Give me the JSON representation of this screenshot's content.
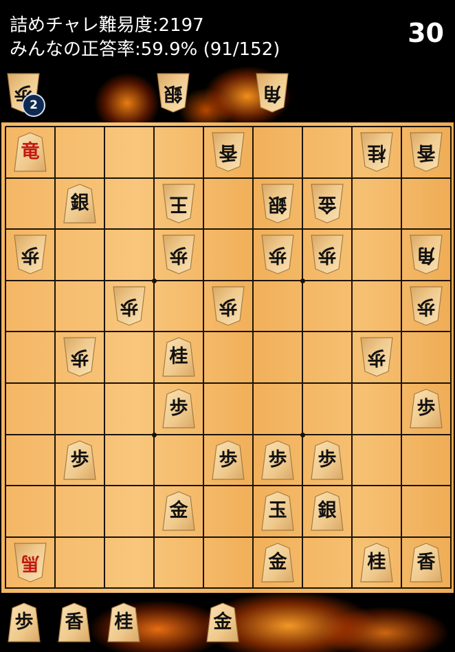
{
  "header": {
    "difficulty": "詰めチャレ難易度:2197",
    "accuracy": "みんなの正答率:59.9% (91/152)",
    "move_count": "30"
  },
  "gote_hand": [
    {
      "label": "歩",
      "count": "2"
    },
    {
      "label": "銀"
    },
    {
      "label": "角"
    }
  ],
  "sente_hand": [
    {
      "label": "歩"
    },
    {
      "label": "香"
    },
    {
      "label": "桂"
    },
    {
      "label": "金"
    }
  ],
  "board": {
    "pieces": [
      {
        "row": 1,
        "col": 1,
        "label": "竜",
        "owner": "sente",
        "promoted": true
      },
      {
        "row": 1,
        "col": 5,
        "label": "香",
        "owner": "gote"
      },
      {
        "row": 1,
        "col": 8,
        "label": "桂",
        "owner": "gote"
      },
      {
        "row": 1,
        "col": 9,
        "label": "香",
        "owner": "gote"
      },
      {
        "row": 2,
        "col": 2,
        "label": "銀",
        "owner": "sente"
      },
      {
        "row": 2,
        "col": 4,
        "label": "王",
        "owner": "gote"
      },
      {
        "row": 2,
        "col": 6,
        "label": "銀",
        "owner": "gote"
      },
      {
        "row": 2,
        "col": 7,
        "label": "金",
        "owner": "gote"
      },
      {
        "row": 3,
        "col": 1,
        "label": "歩",
        "owner": "gote"
      },
      {
        "row": 3,
        "col": 4,
        "label": "歩",
        "owner": "gote"
      },
      {
        "row": 3,
        "col": 6,
        "label": "歩",
        "owner": "gote"
      },
      {
        "row": 3,
        "col": 7,
        "label": "歩",
        "owner": "gote"
      },
      {
        "row": 3,
        "col": 9,
        "label": "角",
        "owner": "gote"
      },
      {
        "row": 4,
        "col": 3,
        "label": "歩",
        "owner": "gote"
      },
      {
        "row": 4,
        "col": 5,
        "label": "歩",
        "owner": "gote"
      },
      {
        "row": 4,
        "col": 9,
        "label": "歩",
        "owner": "gote"
      },
      {
        "row": 5,
        "col": 2,
        "label": "歩",
        "owner": "gote"
      },
      {
        "row": 5,
        "col": 4,
        "label": "桂",
        "owner": "sente"
      },
      {
        "row": 5,
        "col": 8,
        "label": "歩",
        "owner": "gote"
      },
      {
        "row": 6,
        "col": 4,
        "label": "歩",
        "owner": "sente"
      },
      {
        "row": 6,
        "col": 9,
        "label": "歩",
        "owner": "sente"
      },
      {
        "row": 7,
        "col": 2,
        "label": "歩",
        "owner": "sente"
      },
      {
        "row": 7,
        "col": 5,
        "label": "歩",
        "owner": "sente"
      },
      {
        "row": 7,
        "col": 6,
        "label": "歩",
        "owner": "sente"
      },
      {
        "row": 7,
        "col": 7,
        "label": "歩",
        "owner": "sente"
      },
      {
        "row": 8,
        "col": 4,
        "label": "金",
        "owner": "sente"
      },
      {
        "row": 8,
        "col": 6,
        "label": "玉",
        "owner": "sente"
      },
      {
        "row": 8,
        "col": 7,
        "label": "銀",
        "owner": "sente"
      },
      {
        "row": 9,
        "col": 1,
        "label": "馬",
        "owner": "gote",
        "promoted": true
      },
      {
        "row": 9,
        "col": 6,
        "label": "金",
        "owner": "sente"
      },
      {
        "row": 9,
        "col": 8,
        "label": "桂",
        "owner": "sente"
      },
      {
        "row": 9,
        "col": 9,
        "label": "香",
        "owner": "sente"
      }
    ]
  },
  "colors": {
    "board_wood": "#f4b664",
    "piece_wood": "#f3cf94",
    "promoted_text": "#c11a14",
    "badge_bg": "#0f2a52"
  }
}
